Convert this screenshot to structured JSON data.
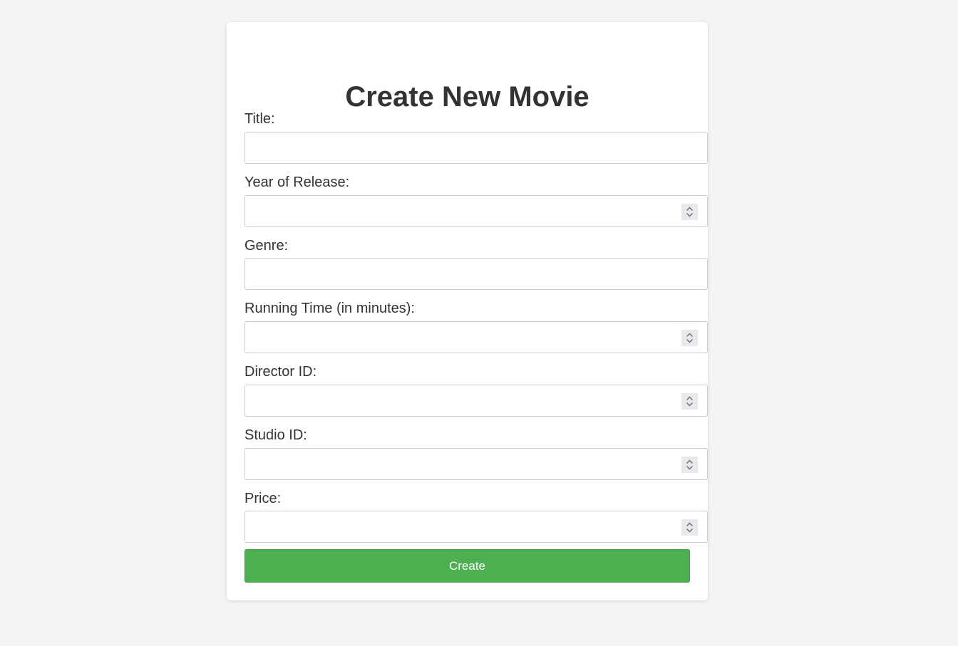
{
  "page": {
    "heading": "Create New Movie"
  },
  "form": {
    "fields": [
      {
        "label": "Title:",
        "value": "",
        "type": "text"
      },
      {
        "label": "Year of Release:",
        "value": "",
        "type": "number"
      },
      {
        "label": "Genre:",
        "value": "",
        "type": "text"
      },
      {
        "label": "Running Time (in minutes):",
        "value": "",
        "type": "number"
      },
      {
        "label": "Director ID:",
        "value": "",
        "type": "number"
      },
      {
        "label": "Studio ID:",
        "value": "",
        "type": "number"
      },
      {
        "label": "Price:",
        "value": "",
        "type": "number"
      }
    ],
    "submit_label": "Create"
  },
  "colors": {
    "page_background": "#f4f4f4",
    "card_background": "#ffffff",
    "submit_button": "#4caf50",
    "text": "#333333"
  },
  "icons": {
    "spinner": "up-down-chevron-icon"
  }
}
